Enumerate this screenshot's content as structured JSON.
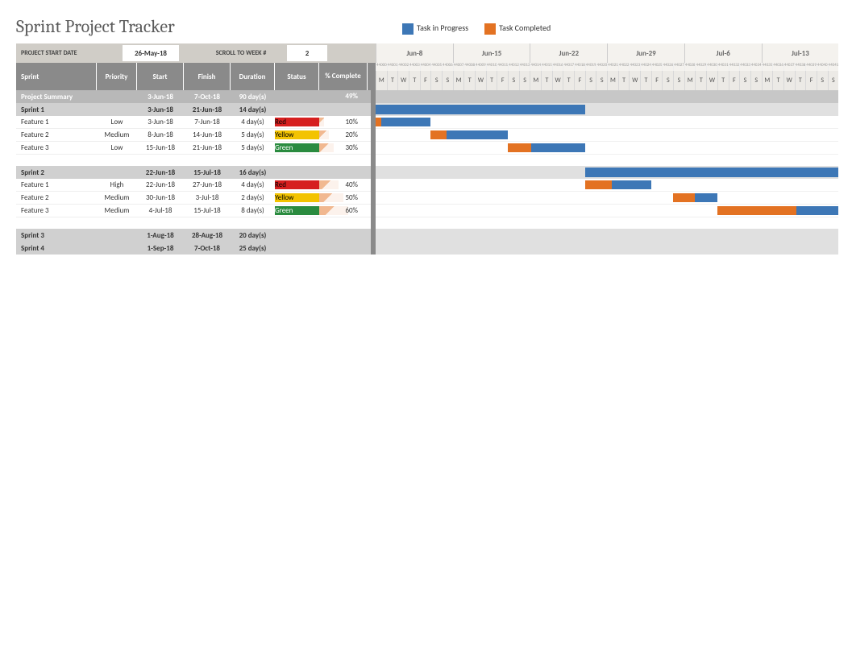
{
  "title": "Sprint Project Tracker",
  "legend": {
    "in_progress": "Task in Progress",
    "completed": "Task Completed"
  },
  "controls": {
    "start_date_label": "PROJECT START DATE",
    "start_date": "26-May-18",
    "scroll_label": "SCROLL TO WEEK #",
    "scroll_week": "2"
  },
  "columns": {
    "sprint": "Sprint",
    "priority": "Priority",
    "start": "Start",
    "finish": "Finish",
    "duration": "Duration",
    "status": "Status",
    "pct": "% Complete"
  },
  "table": [
    {
      "type": "summary",
      "name": "Project Summary",
      "start": "3-Jun-18",
      "finish": "7-Oct-18",
      "duration": "90 day(s)",
      "pct": "49%"
    },
    {
      "type": "sprint",
      "name": "Sprint 1",
      "start": "3-Jun-18",
      "finish": "21-Jun-18",
      "duration": "14 day(s)"
    },
    {
      "type": "task",
      "name": "Feature 1",
      "priority": "Low",
      "start": "3-Jun-18",
      "finish": "7-Jun-18",
      "duration": "4 day(s)",
      "status": "Red",
      "pct": "10%",
      "bar_start": 0,
      "bar_days": 5,
      "done_days": 0.5
    },
    {
      "type": "task",
      "name": "Feature 2",
      "priority": "Medium",
      "start": "8-Jun-18",
      "finish": "14-Jun-18",
      "duration": "5 day(s)",
      "status": "Yellow",
      "pct": "20%",
      "bar_start": 5,
      "bar_days": 7,
      "done_days": 1.4
    },
    {
      "type": "task",
      "name": "Feature 3",
      "priority": "Low",
      "start": "15-Jun-18",
      "finish": "21-Jun-18",
      "duration": "5 day(s)",
      "status": "Green",
      "pct": "30%",
      "bar_start": 12,
      "bar_days": 7,
      "done_days": 2.1
    },
    {
      "type": "spacer"
    },
    {
      "type": "sprint",
      "name": "Sprint 2",
      "start": "22-Jun-18",
      "finish": "15-Jul-18",
      "duration": "16 day(s)"
    },
    {
      "type": "task",
      "name": "Feature 1",
      "priority": "High",
      "start": "22-Jun-18",
      "finish": "27-Jun-18",
      "duration": "4 day(s)",
      "status": "Red",
      "pct": "40%",
      "bar_start": 19,
      "bar_days": 6,
      "done_days": 2.4
    },
    {
      "type": "task",
      "name": "Feature 2",
      "priority": "Medium",
      "start": "30-Jun-18",
      "finish": "3-Jul-18",
      "duration": "2 day(s)",
      "status": "Yellow",
      "pct": "50%",
      "bar_start": 27,
      "bar_days": 4,
      "done_days": 2
    },
    {
      "type": "task",
      "name": "Feature 3",
      "priority": "Medium",
      "start": "4-Jul-18",
      "finish": "15-Jul-18",
      "duration": "8 day(s)",
      "status": "Green",
      "pct": "60%",
      "bar_start": 31,
      "bar_days": 12,
      "done_days": 7.2
    },
    {
      "type": "spacer"
    },
    {
      "type": "sprint",
      "name": "Sprint 3",
      "start": "1-Aug-18",
      "finish": "28-Aug-18",
      "duration": "20 day(s)"
    },
    {
      "type": "sprint",
      "name": "Sprint 4",
      "start": "1-Sep-18",
      "finish": "7-Oct-18",
      "duration": "25 day(s)"
    }
  ],
  "sprint_gantt": {
    "1": {
      "start": 0,
      "days": 19
    },
    "6": {
      "start": 19,
      "days": 24
    }
  },
  "weeks": [
    "Jun-8",
    "Jun-15",
    "Jun-22",
    "Jun-29",
    "Jul-6",
    "Jul-13"
  ],
  "serials_base": 44000,
  "dow_pattern": [
    "M",
    "T",
    "W",
    "T",
    "F",
    "S",
    "S"
  ],
  "days_visible": 42,
  "chart_data": {
    "type": "gantt",
    "title": "Sprint Project Tracker",
    "x_start": "2018-06-04",
    "x_end": "2018-07-15",
    "series": [
      {
        "name": "Sprint 1",
        "start": "2018-06-03",
        "finish": "2018-06-21"
      },
      {
        "name": "Sprint 1 / Feature 1",
        "start": "2018-06-03",
        "finish": "2018-06-07",
        "pct": 10
      },
      {
        "name": "Sprint 1 / Feature 2",
        "start": "2018-06-08",
        "finish": "2018-06-14",
        "pct": 20
      },
      {
        "name": "Sprint 1 / Feature 3",
        "start": "2018-06-15",
        "finish": "2018-06-21",
        "pct": 30
      },
      {
        "name": "Sprint 2",
        "start": "2018-06-22",
        "finish": "2018-07-15"
      },
      {
        "name": "Sprint 2 / Feature 1",
        "start": "2018-06-22",
        "finish": "2018-06-27",
        "pct": 40
      },
      {
        "name": "Sprint 2 / Feature 2",
        "start": "2018-06-30",
        "finish": "2018-07-03",
        "pct": 50
      },
      {
        "name": "Sprint 2 / Feature 3",
        "start": "2018-07-04",
        "finish": "2018-07-15",
        "pct": 60
      }
    ],
    "legend": [
      "Task in Progress",
      "Task Completed"
    ]
  }
}
